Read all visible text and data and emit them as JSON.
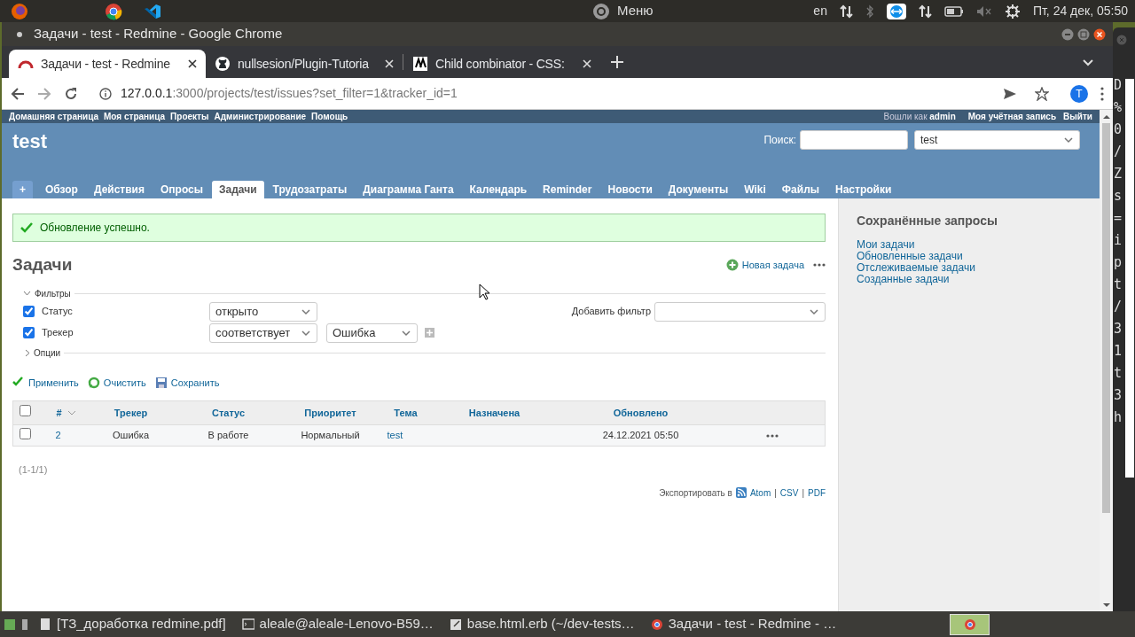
{
  "desktop_panel": {
    "menu": "Меню",
    "keyboard": "en",
    "clock": "Пт, 24 дек, 05:50"
  },
  "browser": {
    "window_title": "Задачи - test - Redmine - Google Chrome",
    "tabs": [
      {
        "title": "Задачи - test - Redmine",
        "kind": "redmine",
        "selected": true
      },
      {
        "title": "nullsesion/Plugin-Tutoria",
        "kind": "github",
        "selected": false
      },
      {
        "title": "Child combinator - CSS:",
        "kind": "mdn",
        "selected": false
      }
    ],
    "url_host": "127.0.0.1",
    "url_rest": ":3000/projects/test/issues?set_filter=1&tracker_id=1",
    "profile_initial": "T"
  },
  "redmine": {
    "top_menu": [
      "Домашняя страница",
      "Моя страница",
      "Проекты",
      "Администрирование",
      "Помощь"
    ],
    "logged_in_label": "Вошли как",
    "user": "admin",
    "account_links": [
      "Моя учётная запись",
      "Выйти"
    ],
    "project_title": "test",
    "search_label": "Поиск:",
    "project_jump": "test",
    "new_object_button": "+",
    "tabs": [
      {
        "label": "Обзор",
        "selected": false
      },
      {
        "label": "Действия",
        "selected": false
      },
      {
        "label": "Опросы",
        "selected": false
      },
      {
        "label": "Задачи",
        "selected": true
      },
      {
        "label": "Трудозатраты",
        "selected": false
      },
      {
        "label": "Диаграмма Ганта",
        "selected": false
      },
      {
        "label": "Календарь",
        "selected": false
      },
      {
        "label": "Reminder",
        "selected": false
      },
      {
        "label": "Новости",
        "selected": false
      },
      {
        "label": "Документы",
        "selected": false
      },
      {
        "label": "Wiki",
        "selected": false
      },
      {
        "label": "Файлы",
        "selected": false
      },
      {
        "label": "Настройки",
        "selected": false
      }
    ],
    "flash": "Обновление успешно.",
    "heading": "Задачи",
    "new_issue": "Новая задача",
    "filters_legend": "Фильтры",
    "filters": [
      {
        "label": "Статус",
        "checked": true,
        "operator": "открыто"
      },
      {
        "label": "Трекер",
        "checked": true,
        "operator": "соответствует",
        "value": "Ошибка"
      }
    ],
    "add_filter_label": "Добавить фильтр",
    "options_legend": "Опции",
    "actions": [
      {
        "label": "Применить",
        "kind": "apply"
      },
      {
        "label": "Очистить",
        "kind": "clear"
      },
      {
        "label": "Сохранить",
        "kind": "save"
      }
    ],
    "table": {
      "select_all_checked": false,
      "columns": [
        "#",
        "Трекер",
        "Статус",
        "Приоритет",
        "Тема",
        "Назначена",
        "Обновлено"
      ],
      "rows": [
        {
          "checked": false,
          "id": "2",
          "tracker": "Ошибка",
          "status": "В работе",
          "priority": "Нормальный",
          "subject": "test",
          "updated": "24.12.2021 05:50"
        }
      ]
    },
    "pagination": "(1-1/1)",
    "export_label": "Экспортировать в",
    "export_links": [
      "Atom",
      "CSV",
      "PDF"
    ],
    "export_separator": "|",
    "sidebar": {
      "title": "Сохранённые запросы",
      "links": [
        "Мои задачи",
        "Обновленные задачи",
        "Отслеживаемые задачи",
        "Созданные задачи"
      ]
    }
  },
  "terminal_chars": [
    "D",
    "%",
    "0",
    "/",
    "Z",
    "s",
    "=",
    "i",
    "p",
    "t",
    "/",
    "3",
    "1",
    "t",
    "3",
    "h"
  ],
  "taskbar": [
    {
      "title": "[ТЗ_доработка redmine.pdf]",
      "kind": "document"
    },
    {
      "title": "aleale@aleale-Lenovo-B59…",
      "kind": "terminal"
    },
    {
      "title": "base.html.erb (~/dev-tests…",
      "kind": "editor"
    },
    {
      "title": "Задачи - test - Redmine - …",
      "kind": "browser"
    }
  ]
}
